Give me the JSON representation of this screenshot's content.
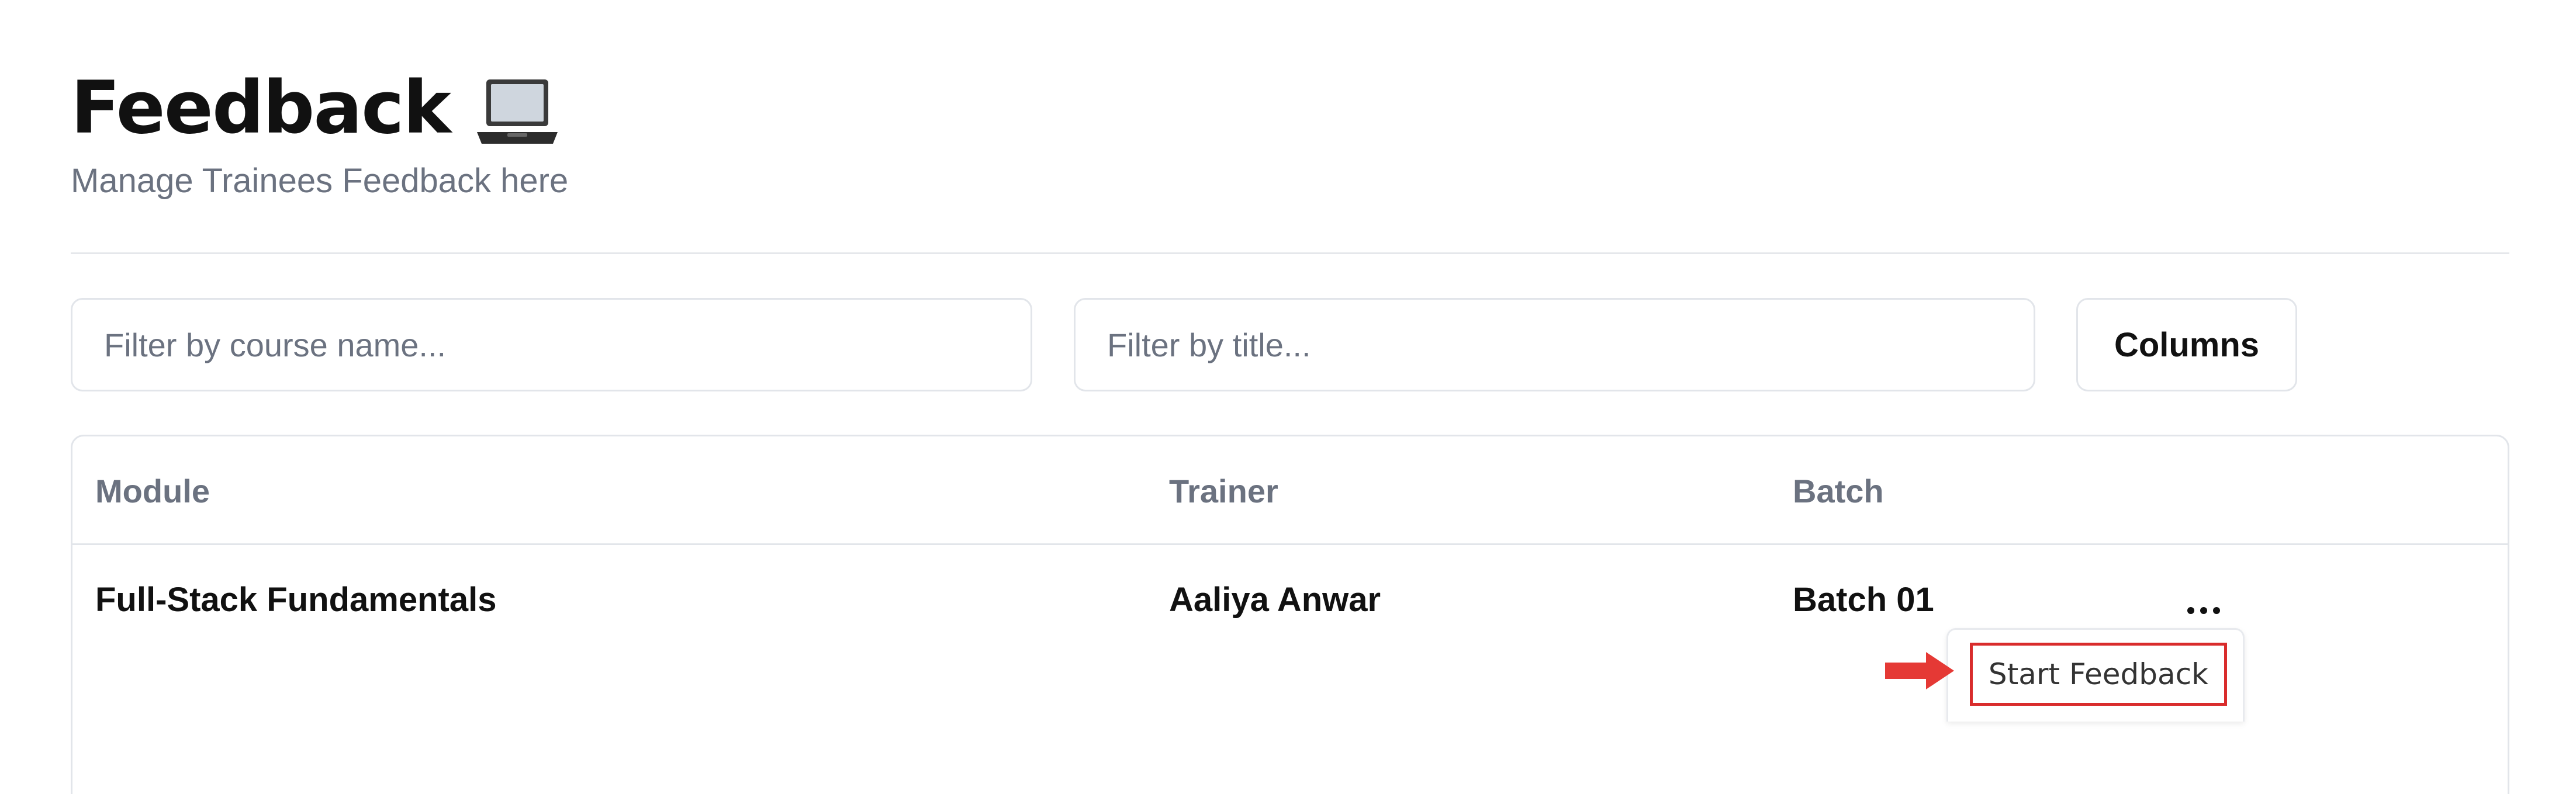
{
  "header": {
    "title": "Feedback",
    "subtitle": "Manage Trainees Feedback here",
    "icon": "laptop-icon"
  },
  "filters": {
    "course_placeholder": "Filter by course name...",
    "title_placeholder": "Filter by title...",
    "columns_label": "Columns"
  },
  "table": {
    "columns": [
      "Module",
      "Trainer",
      "Batch"
    ],
    "rows": [
      {
        "module": "Full-Stack Fundamentals",
        "trainer": "Aaliya Anwar",
        "batch": "Batch 01"
      }
    ],
    "row_actions_icon": "more-horizontal-icon"
  },
  "action_menu": {
    "items": [
      "Start Feedback"
    ]
  },
  "annotation": {
    "arrow_color": "#e53935",
    "highlight_color": "#d92c2c"
  }
}
